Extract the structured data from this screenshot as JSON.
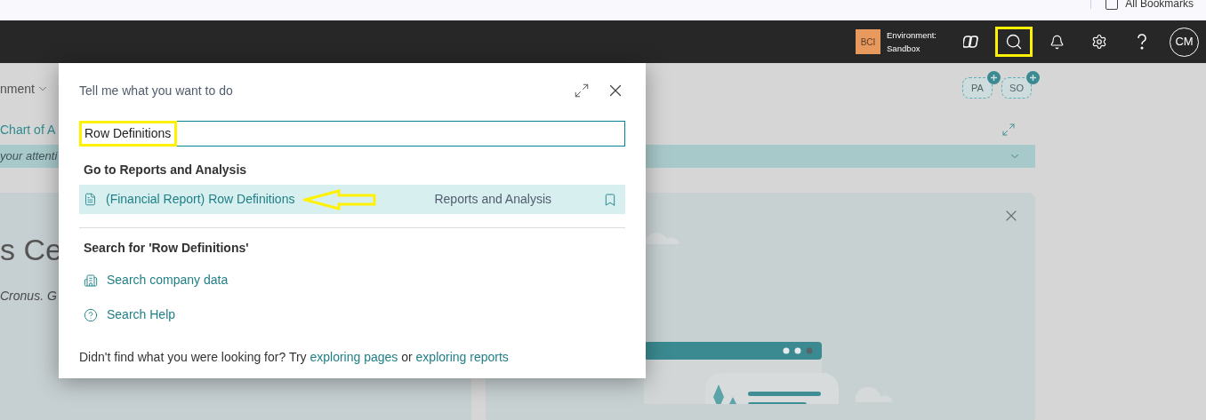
{
  "bookmarks_bar": {
    "label": "All Bookmarks"
  },
  "header": {
    "environment_badge": "BCI",
    "environment_label": "Environment:",
    "environment_name": "Sandbox",
    "avatar": "CM",
    "buttons": [
      {
        "kind": "copilot",
        "highlighted": false
      },
      {
        "kind": "search",
        "highlighted": true
      },
      {
        "kind": "notifications",
        "highlighted": false
      },
      {
        "kind": "settings",
        "highlighted": false
      },
      {
        "kind": "help",
        "highlighted": false
      }
    ]
  },
  "background": {
    "menu_label": "nment",
    "link": "Chart of A",
    "banner": "your attenti",
    "title": "s Ce",
    "greeting": "Cronus. G",
    "badges": [
      "PA",
      "SO"
    ]
  },
  "dialog": {
    "title": "Tell me what you want to do",
    "search": {
      "value": "Row Definitions",
      "highlighted": true
    },
    "sections": [
      {
        "heading": "Go to Reports and Analysis",
        "items": [
          {
            "kind": "page",
            "label": "(Financial Report) Row Definitions",
            "category": "Reports and Analysis",
            "selected": true,
            "arrow": true
          }
        ]
      },
      {
        "heading": "Search for 'Row Definitions'",
        "items": [
          {
            "kind": "company_data",
            "label": "Search company data",
            "selected": false,
            "arrow": false
          },
          {
            "kind": "help",
            "label": "Search Help",
            "selected": false,
            "arrow": false
          }
        ]
      }
    ],
    "footer": [
      {
        "kind": "text",
        "text": "Didn't find what you were looking for? Try"
      },
      {
        "kind": "link",
        "text": "exploring pages"
      },
      {
        "kind": "text",
        "text": "or"
      },
      {
        "kind": "link",
        "text": "exploring reports"
      }
    ]
  }
}
